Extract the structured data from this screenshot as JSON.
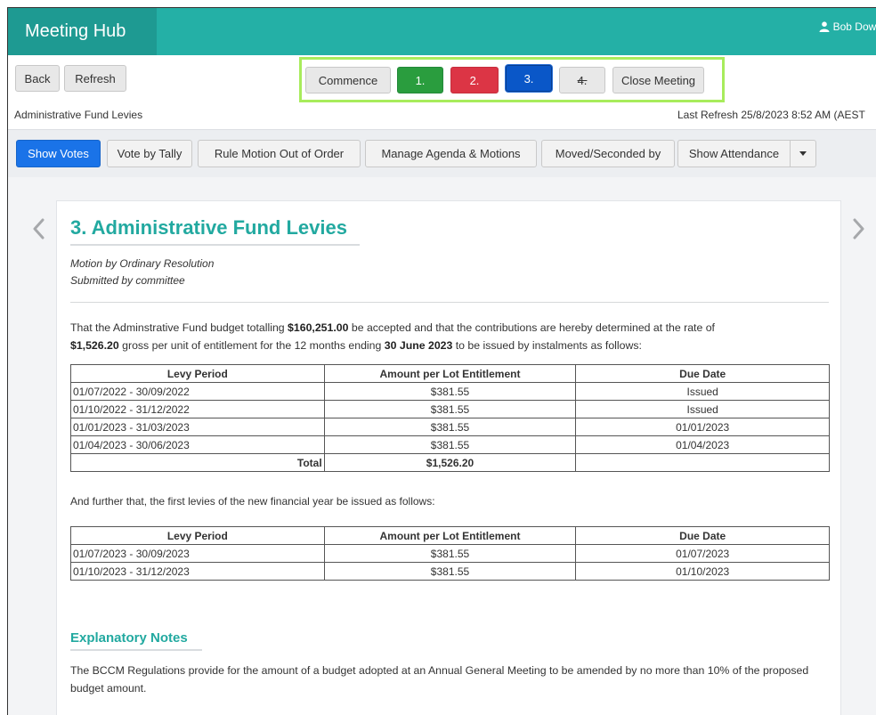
{
  "app": {
    "title": "Meeting Hub",
    "user_name": "Bob Down"
  },
  "toolbar": {
    "back_label": "Back",
    "refresh_label": "Refresh",
    "steps": [
      "Commence",
      "1.",
      "2.",
      "3.",
      "4.",
      "Close Meeting"
    ]
  },
  "header": {
    "subtitle": "Administrative Fund Levies",
    "last_refresh": "Last Refresh 25/8/2023 8:52 AM (AEST"
  },
  "actions": [
    "Show Votes",
    "Vote by Tally",
    "Rule Motion Out of Order",
    "Manage Agenda & Motions",
    "Moved/Seconded by",
    "Show Attendance"
  ],
  "motion": {
    "title": "3. Administrative Fund Levies",
    "type": "Motion by Ordinary Resolution",
    "submitted": "Submitted by committee",
    "para_a": "That the Adminstrative Fund budget totalling ",
    "budget": "$160,251.00",
    "para_b": " be accepted and that the contributions are hereby determined at the rate of ",
    "rate": "$1,526.20",
    "para_c": " gross per unit of entitlement for the 12 months ending ",
    "end_date": "30 June 2023",
    "para_d": " to be issued by instalments as follows:",
    "table_headers": [
      "Levy Period",
      "Amount per Lot Entitlement",
      "Due Date"
    ],
    "table1": [
      [
        "01/07/2022 - 30/09/2022",
        "$381.55",
        "Issued"
      ],
      [
        "01/10/2022 - 31/12/2022",
        "$381.55",
        "Issued"
      ],
      [
        "01/01/2023 - 31/03/2023",
        "$381.55",
        "01/01/2023"
      ],
      [
        "01/04/2023 - 30/06/2023",
        "$381.55",
        "01/04/2023"
      ]
    ],
    "total_label": "Total",
    "total_value": "$1,526.20",
    "further": "And further that, the first levies of the new financial year be issued as follows:",
    "table2": [
      [
        "01/07/2023 - 30/09/2023",
        "$381.55",
        "01/07/2023"
      ],
      [
        "01/10/2023 - 31/12/2023",
        "$381.55",
        "01/10/2023"
      ]
    ],
    "notes_heading": "Explanatory Notes",
    "notes_text": "The BCCM Regulations provide for the amount of a budget adopted at an Annual General Meeting to be amended by no more than 10% of the proposed budget amount."
  },
  "colors": {
    "topbar": "#24b0a6",
    "brand": "#1e9a92",
    "accent": "#22a9a0",
    "step_done": "#2a9d3e",
    "step_fail": "#dc3545",
    "step_current": "#0a57c8",
    "primary": "#1a73e8",
    "highlight_frame": "#a8ec5c"
  },
  "icons": [
    "user-icon",
    "chevron-left-icon",
    "chevron-right-icon",
    "caret-down-icon"
  ]
}
